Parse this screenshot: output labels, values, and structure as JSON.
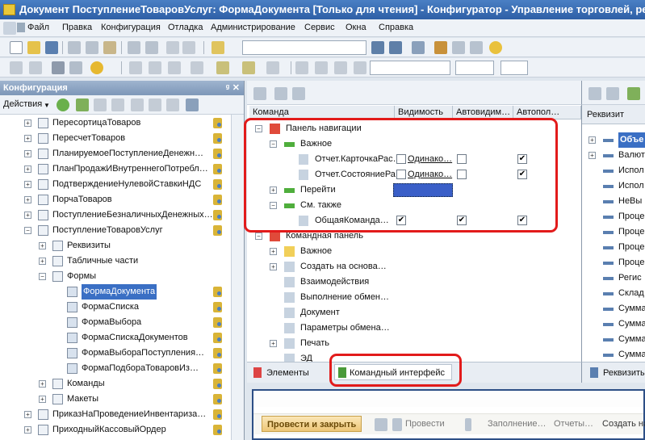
{
  "window": {
    "title": "Документ ПоступлениеТоваровУслуг: ФормаДокумента [Только для чтения] - Конфигуратор - Управление торговлей, ре"
  },
  "menu": [
    "Файл",
    "Правка",
    "Конфигурация",
    "Отладка",
    "Администрирование",
    "Сервис",
    "Окна",
    "Справка"
  ],
  "config_panel": {
    "title": "Конфигурация",
    "pin": "ᵍ",
    "close": "✕",
    "actions_label": "Действия",
    "items": [
      {
        "label": "ПересортицаТоваров",
        "level": 0
      },
      {
        "label": "ПересчетТоваров",
        "level": 0
      },
      {
        "label": "ПланируемоеПоступлениеДенежн…",
        "level": 0
      },
      {
        "label": "ПланПродажИВнутреннегоПотребл…",
        "level": 0
      },
      {
        "label": "ПодтверждениеНулевойСтавкиНДС",
        "level": 0
      },
      {
        "label": "ПорчаТоваров",
        "level": 0
      },
      {
        "label": "ПоступлениеБезналичныхДенежных…",
        "level": 0
      },
      {
        "label": "ПоступлениеТоваровУслуг",
        "level": 0
      },
      {
        "label": "Реквизиты",
        "level": 1
      },
      {
        "label": "Табличные части",
        "level": 1
      },
      {
        "label": "Формы",
        "level": 1
      },
      {
        "label": "ФормаДокумента",
        "level": 2
      },
      {
        "label": "ФормаСписка",
        "level": 2
      },
      {
        "label": "ФормаВыбора",
        "level": 2
      },
      {
        "label": "ФормаСпискаДокументов",
        "level": 2
      },
      {
        "label": "ФормаВыбораПоступления…",
        "level": 2
      },
      {
        "label": "ФормаПодбораТоваровИз…",
        "level": 2
      },
      {
        "label": "Команды",
        "level": 1
      },
      {
        "label": "Макеты",
        "level": 1
      },
      {
        "label": "ПриказНаПроведениеИнвентариза…",
        "level": 0
      },
      {
        "label": "ПриходныйКассовыйОрдер",
        "level": 0
      }
    ]
  },
  "command_panel": {
    "columns": [
      "Команда",
      "Видимость",
      "Автовидим…",
      "Автопол…"
    ],
    "rows": [
      {
        "label": "Панель навигации",
        "indent": 0,
        "expander": "−"
      },
      {
        "label": "Важное",
        "indent": 1,
        "expander": "−"
      },
      {
        "label": "Отчет.КарточкаРас…",
        "indent": 2,
        "vis_text": "Одинако…",
        "c1": "",
        "c2": "",
        "c3": "✔"
      },
      {
        "label": "Отчет.СостояниеРа…",
        "indent": 2,
        "vis_text": "Одинако…",
        "c1": "",
        "c2": "",
        "c3": "✔"
      },
      {
        "label": "Перейти",
        "indent": 1,
        "expander": "+"
      },
      {
        "label": "См. также",
        "indent": 1,
        "expander": "−"
      },
      {
        "label": "ОбщаяКоманда…",
        "indent": 2,
        "c1": "✔",
        "c2": "✔",
        "c3": "✔"
      },
      {
        "label": "Командная панель",
        "indent": 0,
        "expander": "−"
      },
      {
        "label": "Важное",
        "indent": 1,
        "expander": "+"
      },
      {
        "label": "Создать на основа…",
        "indent": 1,
        "expander": "+"
      },
      {
        "label": "Взаимодействия",
        "indent": 1
      },
      {
        "label": "Выполнение обмен…",
        "indent": 1
      },
      {
        "label": "Документ",
        "indent": 1
      },
      {
        "label": "Параметры обмена…",
        "indent": 1
      },
      {
        "label": "Печать",
        "indent": 1,
        "expander": "+"
      },
      {
        "label": "ЭД",
        "indent": 1
      }
    ],
    "tabs": [
      "Элементы",
      "Командный интерфейс"
    ]
  },
  "requisites_panel": {
    "header": "Реквизит",
    "items": [
      "Объе",
      "Валют",
      "Испол",
      "Испол",
      "НеВы",
      "Проце",
      "Проце",
      "Проце",
      "Проце",
      "Регис",
      "Склад",
      "Сумма",
      "Сумма",
      "Сумма",
      "Сумма"
    ],
    "tab": "Реквизиты"
  },
  "preview": {
    "buttons": [
      "Провести и закрыть",
      "Провести",
      "Заполнение…",
      "Отчеты…",
      "Создать на"
    ]
  }
}
